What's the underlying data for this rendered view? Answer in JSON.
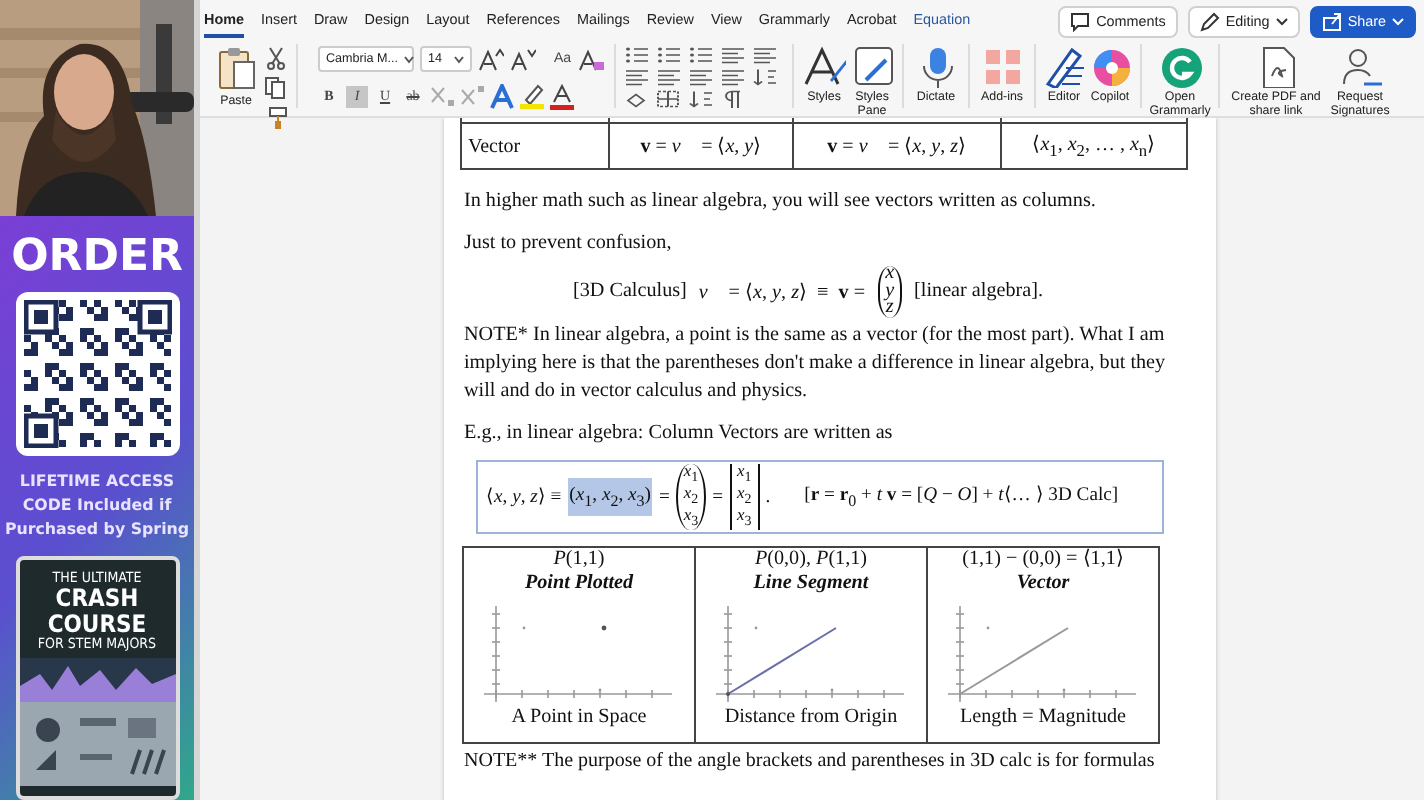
{
  "promo": {
    "heading": "ORDER",
    "text": "LIFETIME ACCESS CODE Included if Purchased by Spring",
    "book": [
      "THE ULTIMATE",
      "CRASH COURSE",
      "FOR STEM MAJORS"
    ]
  },
  "tabs": [
    {
      "label": "Home",
      "selected": true,
      "kind": "standard"
    },
    {
      "label": "Insert",
      "selected": false,
      "kind": "standard"
    },
    {
      "label": "Draw",
      "selected": false,
      "kind": "standard"
    },
    {
      "label": "Design",
      "selected": false,
      "kind": "standard"
    },
    {
      "label": "Layout",
      "selected": false,
      "kind": "standard"
    },
    {
      "label": "References",
      "selected": false,
      "kind": "standard"
    },
    {
      "label": "Mailings",
      "selected": false,
      "kind": "standard"
    },
    {
      "label": "Review",
      "selected": false,
      "kind": "standard"
    },
    {
      "label": "View",
      "selected": false,
      "kind": "standard"
    },
    {
      "label": "Grammarly",
      "selected": false,
      "kind": "standard"
    },
    {
      "label": "Acrobat",
      "selected": false,
      "kind": "standard"
    },
    {
      "label": "Equation",
      "selected": false,
      "kind": "contextual"
    }
  ],
  "header_buttons": [
    {
      "label": "Comments",
      "kind": "comments"
    },
    {
      "label": "Editing",
      "kind": "editing"
    },
    {
      "label": "Share",
      "kind": "share"
    }
  ],
  "ribbon": {
    "paste": "Paste",
    "font_name": "Cambria M...",
    "font_size": "14",
    "case_button": "Aa",
    "format_buttons": [
      {
        "label": "B",
        "kind": "bold",
        "selected": false
      },
      {
        "label": "I",
        "kind": "italic",
        "selected": true
      },
      {
        "label": "U",
        "kind": "underline",
        "selected": false
      },
      {
        "label": "ab",
        "kind": "strike",
        "selected": false
      }
    ],
    "commands": [
      {
        "label": "Styles",
        "kind": "styles"
      },
      {
        "label": "Styles Pane",
        "kind": "styles-pane"
      },
      {
        "label": "Dictate",
        "kind": "dictate"
      },
      {
        "label": "Add-ins",
        "kind": "addins"
      },
      {
        "label": "Editor",
        "kind": "editor"
      },
      {
        "label": "Copilot",
        "kind": "copilot"
      },
      {
        "label": "Open Grammarly",
        "kind": "grammarly"
      },
      {
        "label": "Create PDF and share link",
        "kind": "pdf"
      },
      {
        "label": "Request Signatures",
        "kind": "signatures"
      }
    ]
  },
  "document": {
    "vector_table": {
      "row_label": "Vector",
      "cells": [
        "**v** = *v⃗* = ⟨*x*, *y*⟩",
        "**v** = *v⃗* = ⟨*x*, *y*, *z*⟩",
        "⟨*x*$_{1}$, *x*$_{2}$, … , *x*$_{n}$⟩"
      ]
    },
    "paragraph_1": "In higher math such as linear algebra, you will see vectors written as columns.",
    "paragraph_2": "Just to prevent confusion,",
    "display_equation": {
      "left": "[3D Calculus]",
      "middle": "*v⃗* = ⟨*x*, *y*, *z*⟩  ≡  **v** =",
      "column": [
        "*x*",
        "*y*",
        "*z*"
      ],
      "right": "[linear algebra]."
    },
    "note": "NOTE* In linear algebra, a point is the same as a vector (for the most part). What I am implying here is that the parentheses don't make a difference in linear algebra, but they will and do in vector calculus and physics.",
    "paragraph_3": "E.g., in linear algebra: Column Vectors are written as",
    "equation": [
      {
        "kind": "text",
        "text": "⟨*x*, *y*, *z*⟩ ≡"
      },
      {
        "kind": "selection",
        "text": "(*x*$_{1}$, *x*$_{2}$, *x*$_{3}$)"
      },
      {
        "kind": "text",
        "text": "="
      },
      {
        "kind": "paren-vector",
        "entries": [
          "*x*$_{1}$",
          "*x*$_{2}$",
          "*x*$_{3}$"
        ]
      },
      {
        "kind": "text",
        "text": "="
      },
      {
        "kind": "bracket-vector",
        "entries": [
          "*x*$_{1}$",
          "*x*$_{2}$",
          "*x*$_{3}$"
        ]
      },
      {
        "kind": "text",
        "text": "."
      },
      {
        "kind": "text",
        "text": "[**r** = **r**$_{0}$ + *t* **v** = [*Q* − *O*] + *t*⟨… ⟩ 3D Calc]"
      }
    ],
    "figures": [
      {
        "title": "*P*(1,1)",
        "subtitle": "Point Plotted",
        "caption": "A Point in Space",
        "kind": "point"
      },
      {
        "title": "*P*(0,0), *P*(1,1)",
        "subtitle": "Line Segment",
        "caption": "Distance from Origin",
        "kind": "segment"
      },
      {
        "title": "(1,1) − (0,0) = ⟨1,1⟩",
        "subtitle": "Vector",
        "caption": "Length = Magnitude",
        "kind": "vector"
      }
    ],
    "footer_note": "NOTE** The purpose of the angle brackets and parentheses in 3D calc is for formulas"
  }
}
